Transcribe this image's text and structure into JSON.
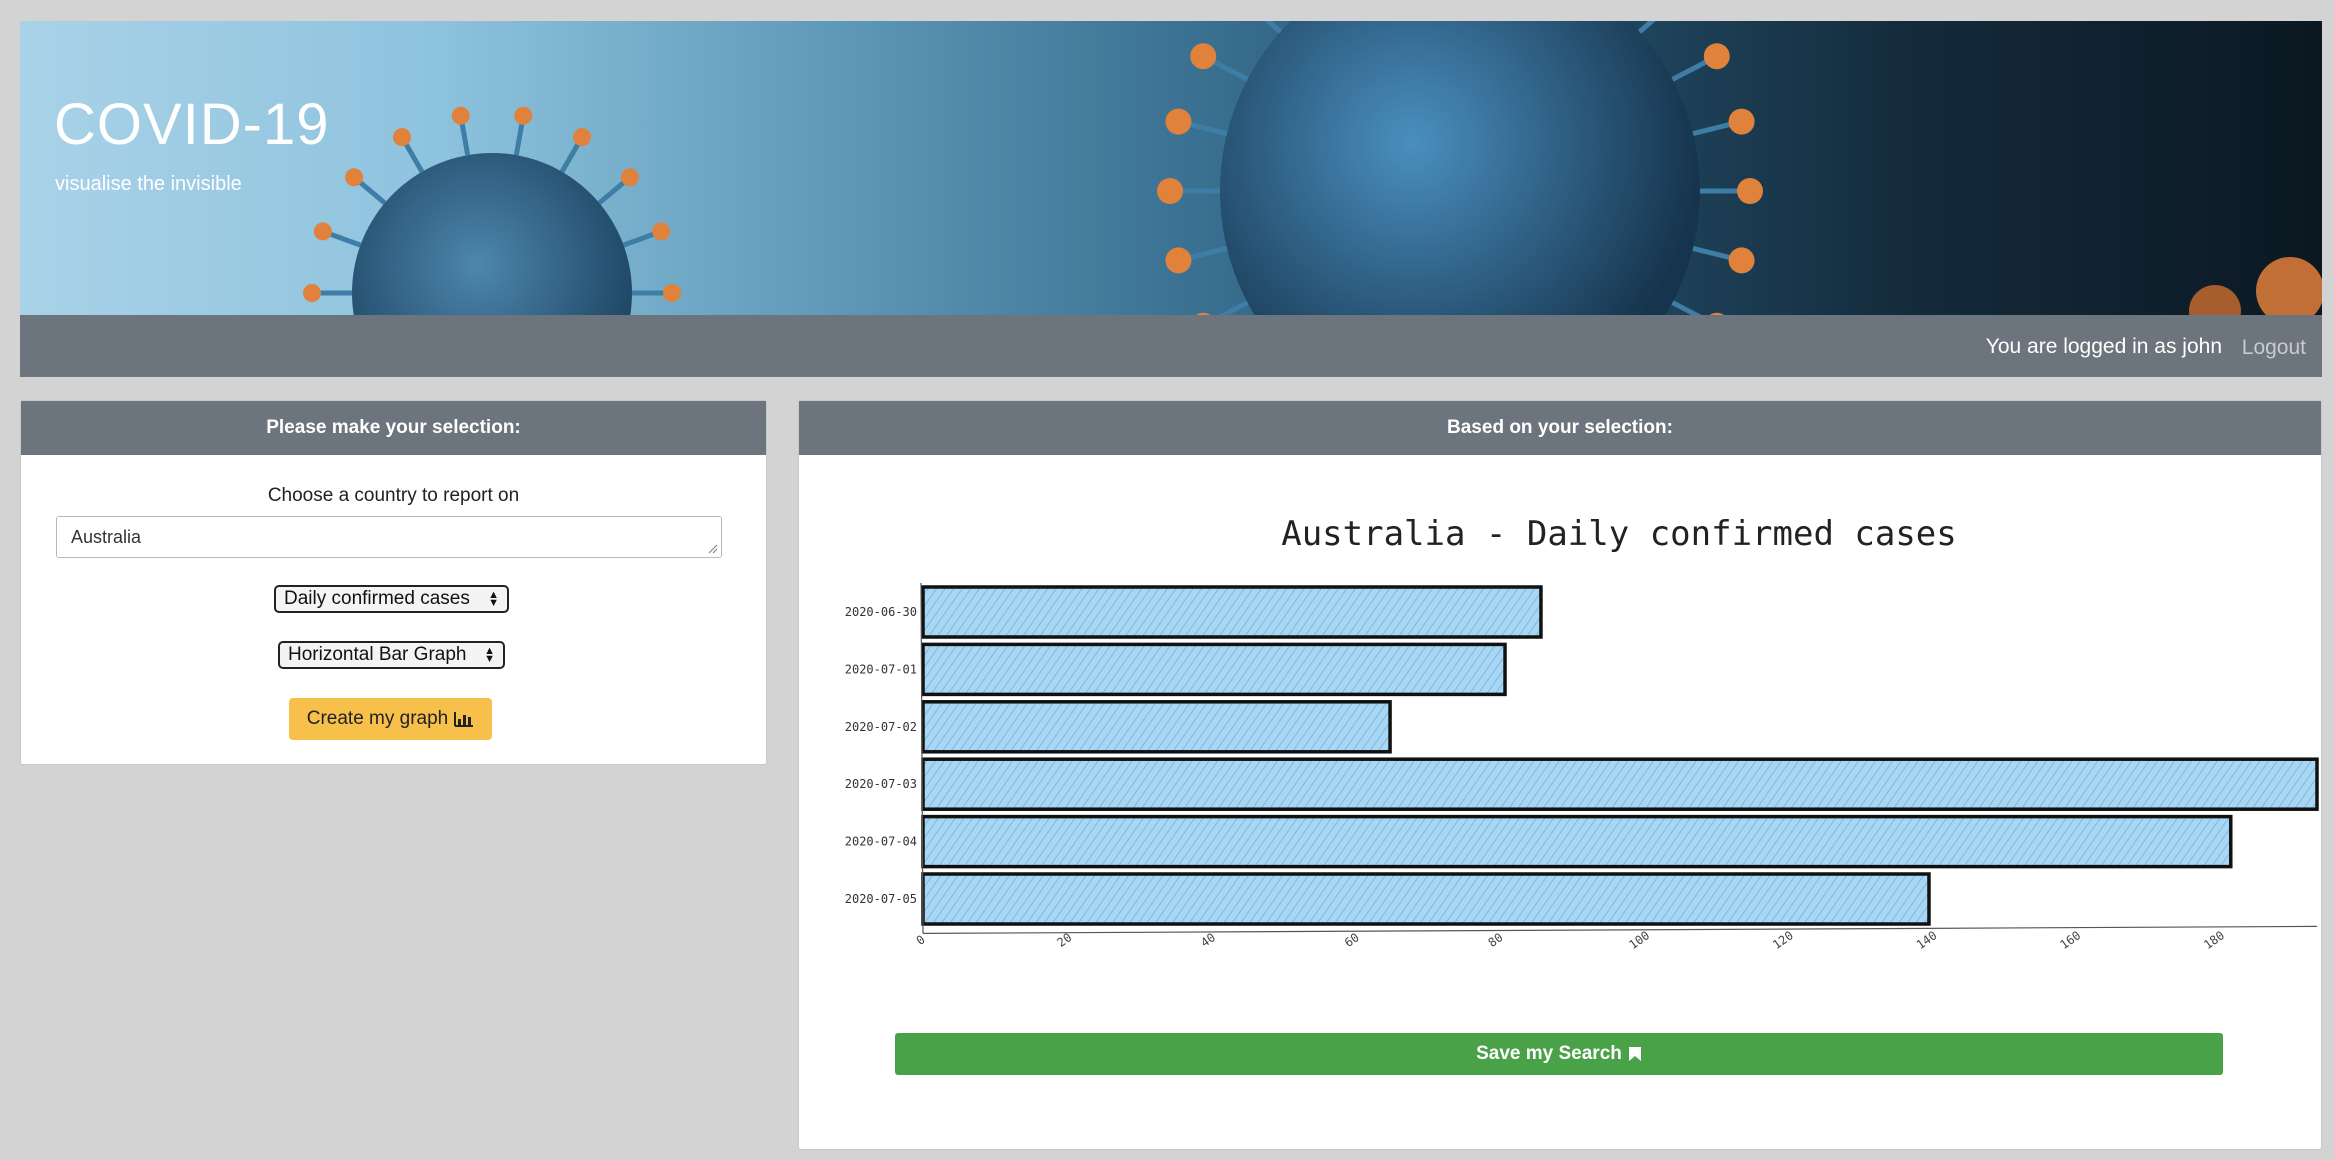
{
  "banner": {
    "title": "COVID-19",
    "subtitle": "visualise the invisible"
  },
  "navbar": {
    "login_text": "You are logged in as john",
    "logout_label": "Logout"
  },
  "selection_panel": {
    "header": "Please make your selection:",
    "country_label": "Choose a country to report on",
    "country_value": "Australia",
    "metric_selected": "Daily confirmed cases",
    "graph_selected": "Horizontal Bar Graph",
    "create_button": "Create my graph"
  },
  "result_panel": {
    "header": "Based on your selection:",
    "save_button": "Save my Search"
  },
  "icons": {
    "create": "bar-chart-icon",
    "save": "bookmark-icon"
  },
  "colors": {
    "navbar": "#6c757d",
    "create_button": "#f7c04a",
    "save_button": "#4aa248",
    "bar_fill": "#8ec8ea"
  },
  "chart_data": {
    "type": "bar",
    "orientation": "horizontal",
    "title": "Australia - Daily confirmed cases",
    "categories": [
      "2020-06-30",
      "2020-07-01",
      "2020-07-02",
      "2020-07-03",
      "2020-07-04",
      "2020-07-05"
    ],
    "values": [
      86,
      81,
      65,
      194,
      182,
      140
    ],
    "xlim": [
      0,
      194
    ],
    "xticks": [
      0,
      20,
      40,
      60,
      80,
      100,
      120,
      140,
      160,
      180
    ],
    "grid": false
  }
}
